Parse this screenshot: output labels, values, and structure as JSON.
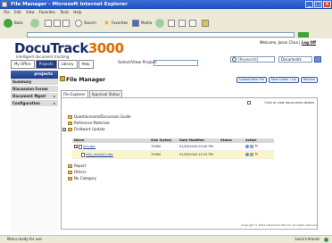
{
  "window": {
    "title": "File Manager - Microsoft Internet Explorer"
  },
  "menu": [
    "File",
    "Edit",
    "View",
    "Favorites",
    "Tools",
    "Help"
  ],
  "toolbar": {
    "back": "Back",
    "search": "Search",
    "favorites": "Favorites",
    "media": "Media"
  },
  "header": {
    "logo_text": "DocuTrack",
    "logo_number": "3000",
    "tagline": "intelligent document tracking",
    "tabs": [
      "My Office",
      "Projects",
      "Library",
      "Help"
    ],
    "view_project_label": "Select/View Project:",
    "welcome": "Welcome, Jason Chua |",
    "logoff": "Log Off",
    "search_placeholder": "[Keywords]",
    "search_scope": "Documents"
  },
  "sidebar": {
    "heading": "projects",
    "items": [
      "Summary",
      "Discussion Forum",
      "Document Mgmt",
      "Configuration"
    ]
  },
  "main": {
    "title": "File Manager",
    "buttons": [
      "Upload New File",
      "New Folder / Up",
      "Refresh"
    ],
    "subtabs": [
      "File Explorer",
      "Approval Status"
    ],
    "click_hint": "Click to view documents details",
    "folders_top": [
      "Questionnaire/Discussion Guide",
      "Reference Materials",
      "Fieldwork Update"
    ],
    "table": {
      "headers": [
        "Name",
        "Size (bytes)",
        "Date Modified",
        "Status",
        "Action"
      ],
      "rows": [
        {
          "name": "Info.doc",
          "size": "79360",
          "date": "01/03/2004 03:40 PM",
          "status": ""
        },
        {
          "name": "Info_version1.doc",
          "size": "79360",
          "date": "01/03/2004 10:15 PM",
          "status": ""
        }
      ]
    },
    "folders_bottom": [
      "Report",
      "Others",
      "No Category"
    ],
    "copyright": "Copyright © 2004 Interactive Pte Ltd. All rights reserved."
  },
  "statusbar": {
    "left": "Menu ready for use",
    "right": "Local intranet"
  }
}
